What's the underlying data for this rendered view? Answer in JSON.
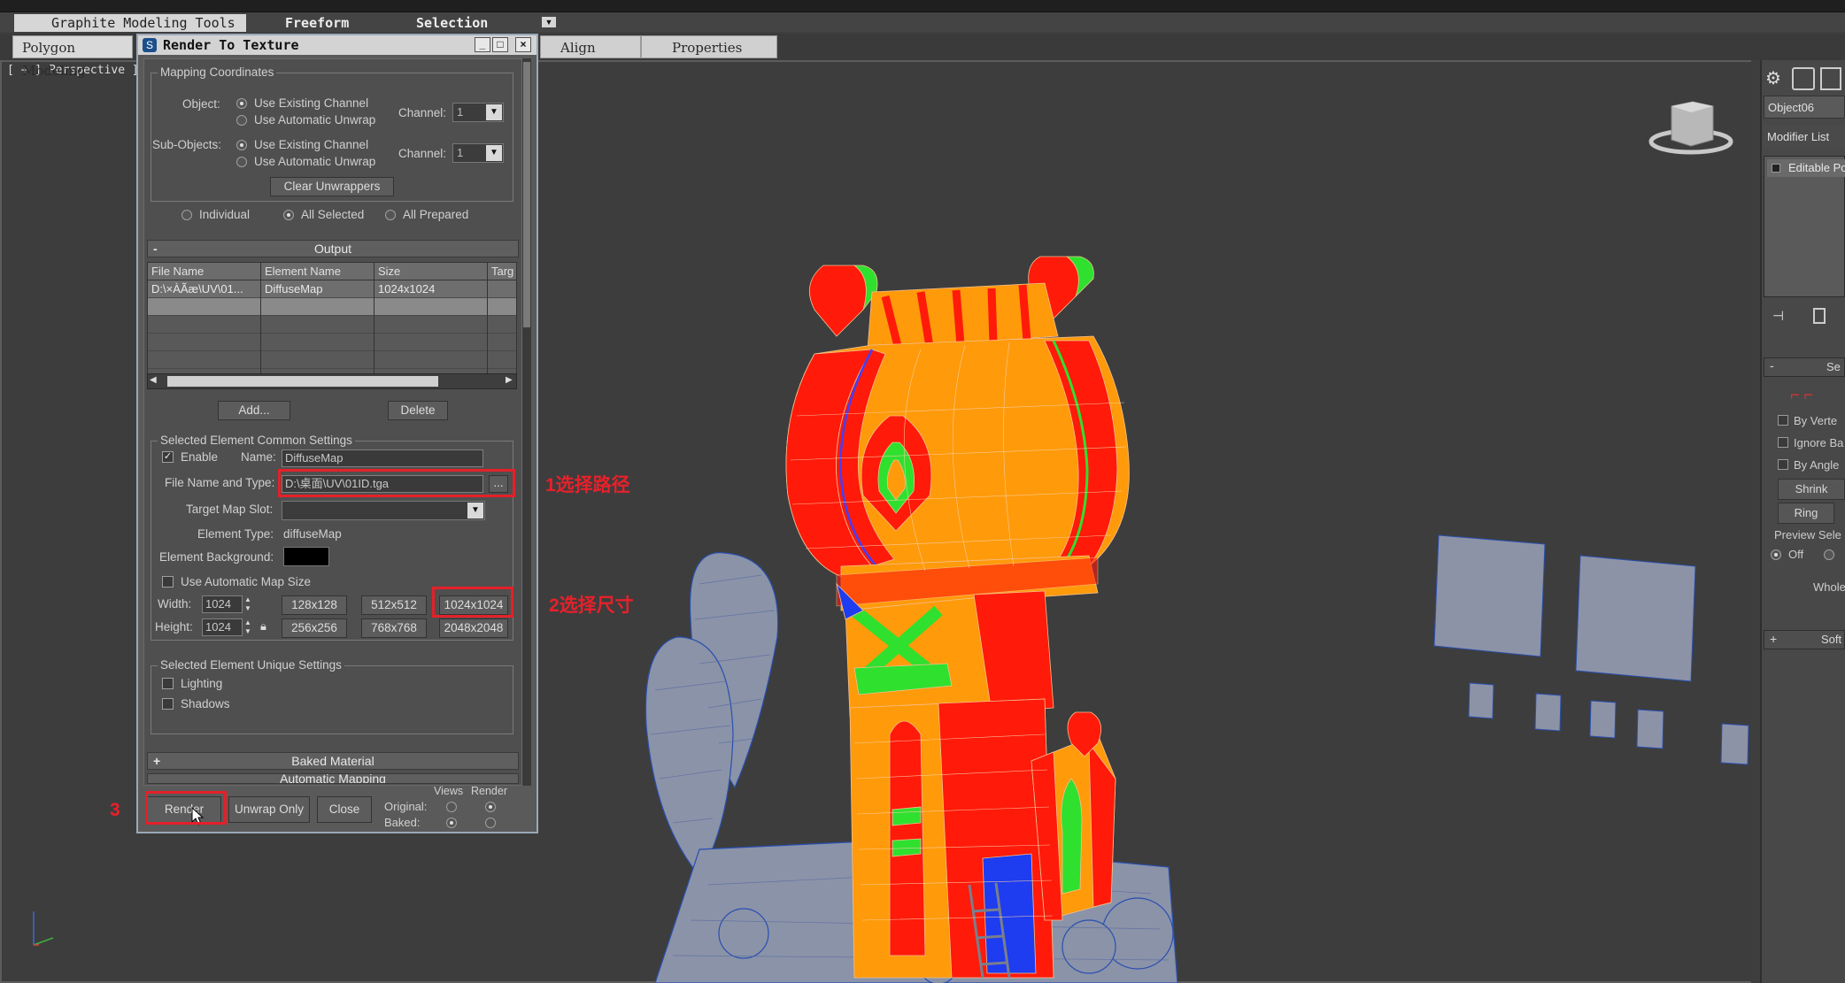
{
  "ribbon": {
    "tabs": [
      "Graphite Modeling Tools",
      "Freeform",
      "Selection"
    ],
    "row2": [
      "Polygon Modeling",
      "Align",
      "Properties"
    ]
  },
  "viewport": {
    "label": "[ + ] Perspective ]"
  },
  "command_panel": {
    "object_name": "Object06",
    "modifier_list": "Modifier List",
    "stack_item": "Editable Po",
    "rollout_sel": "Se",
    "by_vertex": "By Verte",
    "ignore_back": "Ignore Ba",
    "by_angle": "By Angle",
    "shrink": "Shrink",
    "ring": "Ring",
    "preview": "Preview Sele",
    "off": "Off",
    "whole": "Whole",
    "soft": "Soft"
  },
  "dialog": {
    "title": "Render To Texture",
    "mapping": {
      "group_title": "Mapping Coordinates",
      "object_label": "Object:",
      "sub_objects_label": "Sub-Objects:",
      "use_existing": "Use Existing Channel",
      "use_auto": "Use Automatic Unwrap",
      "channel_label": "Channel:",
      "channel_value": "1",
      "clear_unwrappers": "Clear Unwrappers",
      "individual": "Individual",
      "all_selected": "All Selected",
      "all_prepared": "All Prepared"
    },
    "output": {
      "rollout": "Output",
      "columns": [
        "File Name",
        "Element Name",
        "Size",
        "Targ"
      ],
      "rows": [
        {
          "file": "D:\\×ÀÃæ\\UV\\01...",
          "element": "DiffuseMap",
          "size": "1024x1024",
          "target": ""
        }
      ],
      "add_button": "Add...",
      "delete_button": "Delete"
    },
    "common": {
      "group_title": "Selected Element Common Settings",
      "enable": "Enable",
      "name_label": "Name:",
      "name_value": "DiffuseMap",
      "file_label": "File Name and Type:",
      "file_value": "D:\\桌面\\UV\\01ID.tga",
      "browse": "...",
      "target_slot_label": "Target Map Slot:",
      "element_type_label": "Element Type:",
      "element_type_value": "diffuseMap",
      "element_bg_label": "Element Background:",
      "auto_map_size": "Use Automatic Map Size",
      "width_label": "Width:",
      "width_value": "1024",
      "height_label": "Height:",
      "height_value": "1024",
      "presets": [
        "128x128",
        "512x512",
        "1024x1024",
        "256x256",
        "768x768",
        "2048x2048"
      ]
    },
    "unique": {
      "group_title": "Selected Element Unique Settings",
      "lighting": "Lighting",
      "shadows": "Shadows"
    },
    "baked_material": "Baked Material",
    "automatic_mapping": "Automatic Mapping",
    "footer": {
      "render": "Render",
      "unwrap_only": "Unwrap Only",
      "close": "Close",
      "views": "Views",
      "render_col": "Render",
      "original": "Original:",
      "baked": "Baked:"
    }
  },
  "annotations": {
    "step1": "1选择路径",
    "step2": "2选择尺寸",
    "step3": "3"
  },
  "colors": {
    "annotation_red": "#e4202a",
    "model_orange": "#ff9a0a",
    "model_red": "#ff1a0a",
    "model_green": "#2fe02f",
    "model_blue": "#1e3cf0",
    "scenery_gray": "#8a93a8"
  }
}
